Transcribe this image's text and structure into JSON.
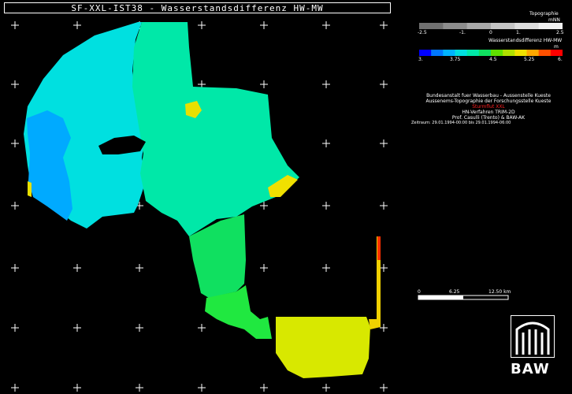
{
  "title": "SF-XXL-IST38 - Wasserstandsdifferenz HW-MW",
  "topography_legend": {
    "title": "Topographie",
    "unit": "mNN",
    "ticks": [
      "-2.5",
      "-1.",
      "0",
      "1.",
      "2.5"
    ],
    "colors": [
      "#707070",
      "#8c8c8c",
      "#a8a8a8",
      "#c4c4c4",
      "#dcdcdc",
      "#f0f0f0"
    ]
  },
  "water_legend": {
    "title": "Wasserstandsdifferenz HW-MW",
    "unit": "m",
    "ticks": [
      "3.",
      "3.75",
      "4.5",
      "5.25",
      "6."
    ],
    "colors": [
      "#0000ff",
      "#0077ff",
      "#00b4ff",
      "#00e0e0",
      "#00e8a8",
      "#10e060",
      "#60e000",
      "#b0e000",
      "#f0e000",
      "#ffa800",
      "#ff5000",
      "#ff0000"
    ]
  },
  "info": {
    "line1": "Bundesanstalt fuer Wasserbau - Aussenstelle Kueste",
    "line2": "Aussenems-Topographie der Forschungsstelle Kueste",
    "line3": "Sturmflut XXL",
    "line4": "HN-Verfahren TRIM-2D",
    "line5": "Prof. Casulli (Trento) & BAW-AK",
    "line6": "Zeitraum: 29.01.1994-00:00 bis 29.01.1994-06:00"
  },
  "scale_bar": {
    "labels": [
      "0",
      "6.25",
      "12.50 km"
    ]
  },
  "logo": {
    "text": "BAW"
  }
}
